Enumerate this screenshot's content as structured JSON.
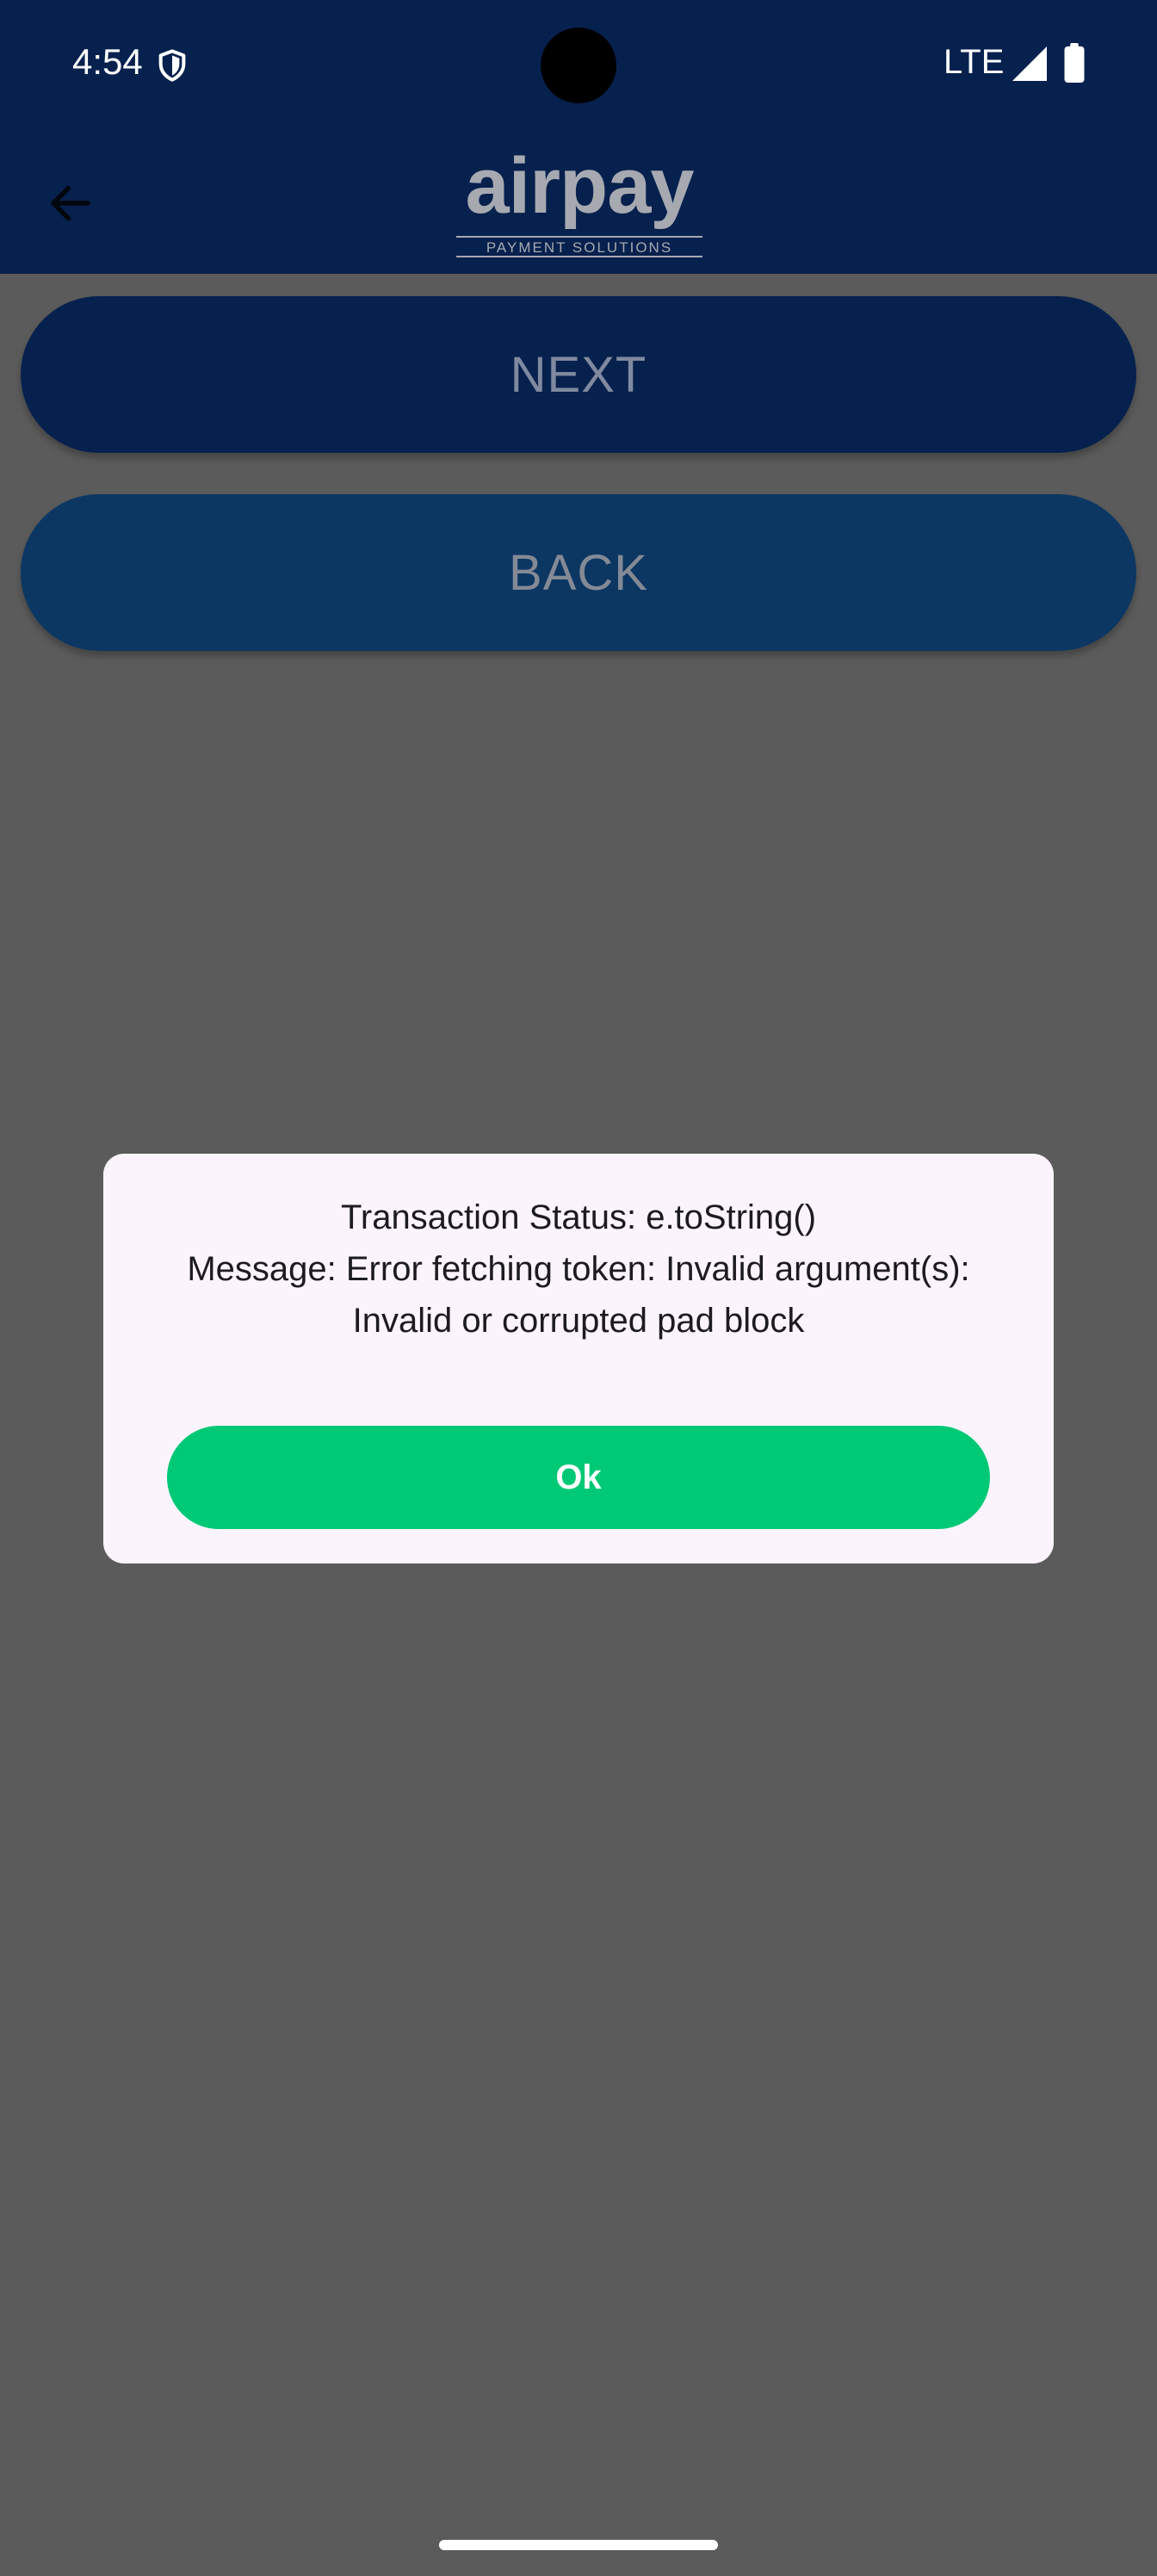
{
  "status_bar": {
    "time": "4:54",
    "network": "LTE",
    "icons": [
      "shield-icon",
      "signal-icon",
      "battery-icon"
    ]
  },
  "app_bar": {
    "logo_text": "airpay",
    "logo_subtitle": "PAYMENT SOLUTIONS",
    "back_icon": "arrow-back-icon"
  },
  "buttons": {
    "next_label": "NEXT",
    "back_label": "BACK"
  },
  "dialog": {
    "line1": "Transaction Status: e.toString()",
    "line2": "Message: Error fetching token: Invalid argument(s):",
    "line3": "Invalid or corrupted pad block",
    "ok_label": "Ok"
  },
  "colors": {
    "app_bar": "#07214e",
    "next_button": "#07214e",
    "back_button": "#0c3763",
    "ok_button": "#00c975",
    "dialog_background": "#fbf4fc",
    "scrim_background": "#5b5b5b"
  }
}
